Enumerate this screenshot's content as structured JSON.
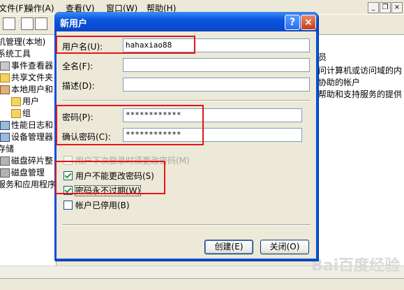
{
  "menubar": {
    "items": [
      {
        "label": "文件(F)"
      },
      {
        "label": "操作(A)"
      },
      {
        "label": "查看(V)"
      },
      {
        "label": "窗口(W)"
      },
      {
        "label": "帮助(H)"
      }
    ],
    "mdi_min": "_",
    "mdi_restore": "❐",
    "mdi_close": "×"
  },
  "tree": {
    "items": [
      {
        "label": "机管理(本地)",
        "icon": "computer-icon"
      },
      {
        "label": "系统工具",
        "icon": "gear-icon"
      },
      {
        "label": "事件查看器",
        "icon": "event-icon"
      },
      {
        "label": "共享文件夹",
        "icon": "folder-icon"
      },
      {
        "label": "本地用户和",
        "icon": "users-icon"
      },
      {
        "label": "用户",
        "icon": "folder-icon"
      },
      {
        "label": "组",
        "icon": "folder-icon"
      },
      {
        "label": "性能日志和",
        "icon": "chart-icon"
      },
      {
        "label": "设备管理器",
        "icon": "device-icon"
      },
      {
        "label": "存储",
        "icon": "disk-icon"
      },
      {
        "label": "磁盘碎片整",
        "icon": "defrag-icon"
      },
      {
        "label": "磁盘管理",
        "icon": "disk-icon"
      },
      {
        "label": "服务和应用程序",
        "icon": "services-icon"
      }
    ]
  },
  "rightpane": {
    "lines": [
      "员",
      "问计算机或访问域的内",
      "协助的帐户",
      "帮助和支持服务的提供"
    ]
  },
  "dialog": {
    "title": "新用户",
    "help_btn": "?",
    "close_btn": "×",
    "username_label": "用户名(U):",
    "username_value": "hahaxiao88",
    "fullname_label": "全名(F):",
    "fullname_value": "",
    "description_label": "描述(D):",
    "description_value": "",
    "password_label": "密码(P):",
    "password_value": "************",
    "confirm_label": "确认密码(C):",
    "confirm_value": "************",
    "cb_must_change": "用户下次登录时须更改密码(M)",
    "cb_cannot_change": "用户不能更改密码(S)",
    "cb_never_expires": "密码永不过期(W)",
    "cb_disabled": "帐户已停用(B)",
    "create_btn": "创建(E)",
    "close_dialog_btn": "关闭(O)"
  },
  "state": {
    "must_change": false,
    "must_change_enabled": false,
    "cannot_change": true,
    "never_expires": true,
    "account_disabled": false
  },
  "watermark": "Bai百度经验",
  "colors": {
    "titlebar": "#0b55e0",
    "highlight": "#e3151a",
    "face": "#ece9d8"
  }
}
